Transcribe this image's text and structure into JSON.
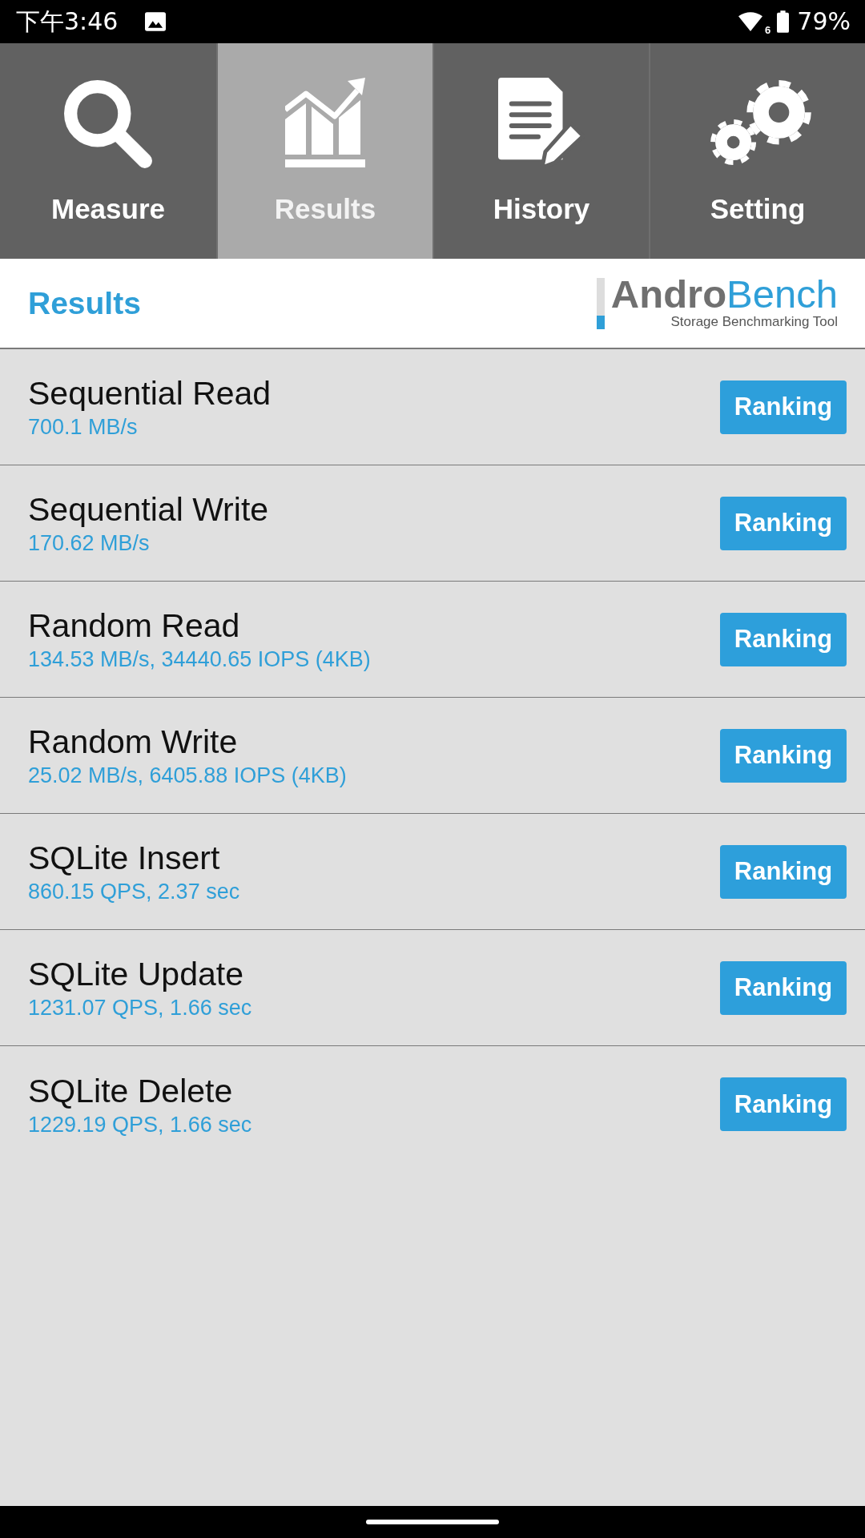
{
  "status_bar": {
    "time": "下午3:46",
    "wifi_badge": "6",
    "battery": "79%"
  },
  "tabs": [
    {
      "kind": "measure",
      "label": "Measure",
      "selected": false
    },
    {
      "kind": "results",
      "label": "Results",
      "selected": true
    },
    {
      "kind": "history",
      "label": "History",
      "selected": false
    },
    {
      "kind": "setting",
      "label": "Setting",
      "selected": false
    }
  ],
  "header": {
    "title": "Results",
    "logo": {
      "name_part_1": "Andro",
      "name_part_2": "Bench",
      "tagline": "Storage Benchmarking Tool"
    }
  },
  "results": [
    {
      "name": "Sequential Read",
      "value": "700.1 MB/s",
      "button": "Ranking"
    },
    {
      "name": "Sequential Write",
      "value": "170.62 MB/s",
      "button": "Ranking"
    },
    {
      "name": "Random Read",
      "value": "134.53 MB/s, 34440.65 IOPS (4KB)",
      "button": "Ranking"
    },
    {
      "name": "Random Write",
      "value": "25.02 MB/s, 6405.88 IOPS (4KB)",
      "button": "Ranking"
    },
    {
      "name": "SQLite Insert",
      "value": "860.15 QPS, 2.37 sec",
      "button": "Ranking"
    },
    {
      "name": "SQLite Update",
      "value": "1231.07 QPS, 1.66 sec",
      "button": "Ranking"
    },
    {
      "name": "SQLite Delete",
      "value": "1229.19 QPS, 1.66 sec",
      "button": "Ranking"
    }
  ]
}
